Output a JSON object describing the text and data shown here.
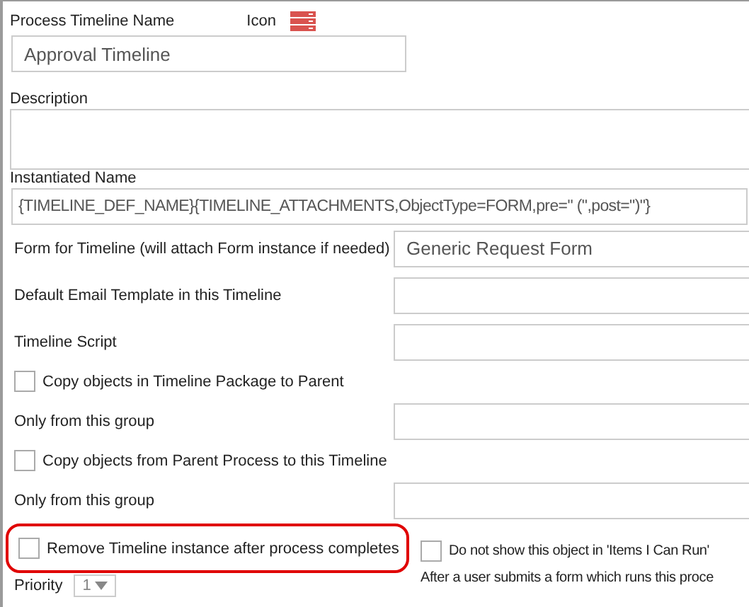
{
  "name_label": "Process Timeline Name",
  "icon_label": "Icon",
  "name_value": "Approval Timeline",
  "description_label": "Description",
  "instantiated_label": "Instantiated Name",
  "instantiated_value": "{TIMELINE_DEF_NAME}{TIMELINE_ATTACHMENTS,ObjectType=FORM,pre=\" (\",post=\")\"}",
  "rows": [
    {
      "kind": "field",
      "label": "Form for Timeline (will attach Form instance if needed)",
      "value": "Generic Request Form"
    },
    {
      "kind": "field",
      "label": "Default Email Template in this Timeline",
      "value": ""
    },
    {
      "kind": "field",
      "label": "Timeline Script",
      "value": ""
    },
    {
      "kind": "checkbox",
      "label": "Copy objects in Timeline Package to Parent",
      "checked": false
    },
    {
      "kind": "field",
      "label": "Only from this group",
      "value": ""
    },
    {
      "kind": "checkbox",
      "label": "Copy objects from Parent Process to this Timeline",
      "checked": false
    },
    {
      "kind": "field",
      "label": "Only from this group",
      "value": ""
    }
  ],
  "remove_option": {
    "label": "Remove Timeline instance after process completes",
    "checked": false,
    "highlighted": true
  },
  "hide_option": {
    "label": "Do not show this object in 'Items I Can Run'",
    "checked": false
  },
  "after_submit_text": "After a user submits a form which runs this proce",
  "priority": {
    "label": "Priority",
    "value": "1"
  }
}
